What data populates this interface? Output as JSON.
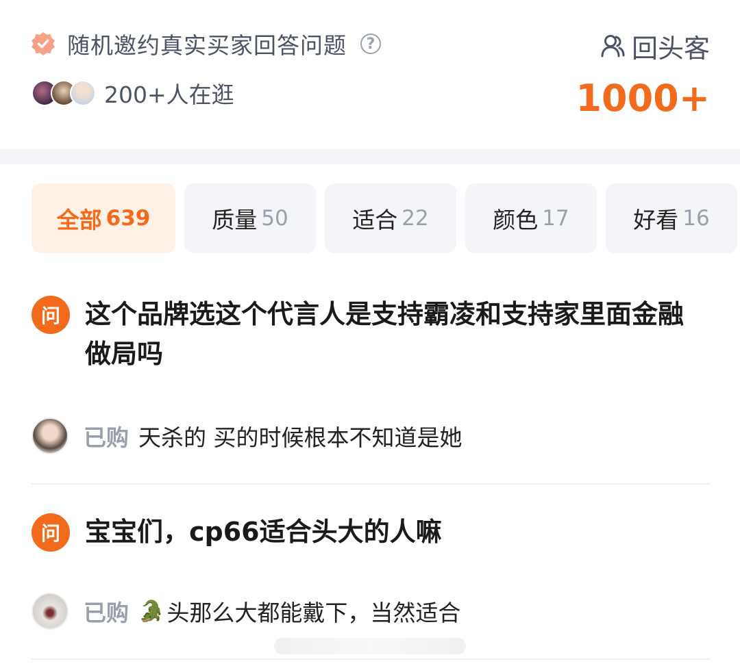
{
  "header": {
    "invite_text": "随机邀约真实买家回答问题",
    "help_icon": "?",
    "browsing_text": "200+人在逛",
    "return_label": "回头客",
    "return_count": "1000+"
  },
  "tabs": [
    {
      "label": "全部",
      "count": "639",
      "active": true
    },
    {
      "label": "质量",
      "count": "50"
    },
    {
      "label": "适合",
      "count": "22"
    },
    {
      "label": "颜色",
      "count": "17"
    },
    {
      "label": "好看",
      "count": "16"
    }
  ],
  "qa": [
    {
      "q_icon": "问",
      "question": "这个品牌选这个代言人是支持霸凌和支持家里面金融做局吗",
      "answer_tag": "已购",
      "answer": "天杀的 买的时候根本不知道是她"
    },
    {
      "q_icon": "问",
      "question": "宝宝们，cp66适合头大的人嘛",
      "answer_tag": "已购",
      "answer_emoji": "🐊",
      "answer": "头那么大都能戴下，当然适合"
    }
  ],
  "colors": {
    "accent": "#f26a1b",
    "tab_bg": "#f3f5f8",
    "tab_active_bg": "#fff1e6",
    "muted_text": "#9aa0ab"
  }
}
